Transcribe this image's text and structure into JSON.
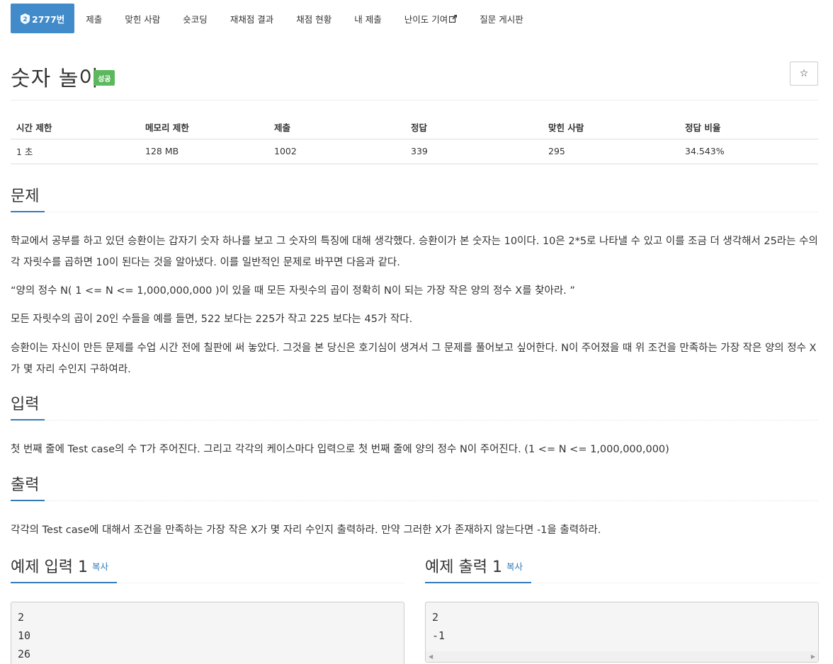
{
  "nav": {
    "problem_id": "2777번",
    "items": [
      "제출",
      "맞힌 사람",
      "숏코딩",
      "재채점 결과",
      "채점 현황",
      "내 제출",
      "난이도 기여",
      "질문 게시판"
    ]
  },
  "problem": {
    "title": "숫자 놀이",
    "status_badge": "성공",
    "star_icon": "☆"
  },
  "info_table": {
    "headers": [
      "시간 제한",
      "메모리 제한",
      "제출",
      "정답",
      "맞힌 사람",
      "정답 비율"
    ],
    "values": [
      "1 초",
      "128 MB",
      "1002",
      "339",
      "295",
      "34.543%"
    ]
  },
  "sections": {
    "description": {
      "heading": "문제",
      "paragraphs": [
        "학교에서 공부를 하고 있던 승환이는 갑자기 숫자 하나를 보고 그 숫자의 특징에 대해 생각했다. 승환이가 본 숫자는 10이다. 10은 2*5로 나타낼 수 있고 이를 조금 더 생각해서 25라는 수의 각 자릿수를 곱하면 10이 된다는 것을 알아냈다. 이를 일반적인 문제로 바꾸면 다음과 같다.",
        "“양의 정수 N( 1 <= N <= 1,000,000,000 )이 있을 때 모든 자릿수의 곱이 정확히 N이 되는 가장 작은 양의 정수 X를 찾아라. ”",
        "모든 자릿수의 곱이 20인 수들을 예를 들면, 522 보다는 225가 작고 225 보다는 45가 작다.",
        "승환이는 자신이 만든 문제를 수업 시간 전에 칠판에 써 놓았다. 그것을 본 당신은 호기심이 생겨서 그 문제를 풀어보고 싶어한다. N이 주어졌을 때 위 조건을 만족하는 가장 작은 양의 정수 X가 몇 자리 수인지 구하여라."
      ]
    },
    "input": {
      "heading": "입력",
      "text": "첫 번째 줄에 Test case의 수 T가 주어진다. 그리고 각각의 케이스마다 입력으로 첫 번째 줄에 양의 정수 N이 주어진다. (1 <= N <= 1,000,000,000)"
    },
    "output": {
      "heading": "출력",
      "text": "각각의 Test case에 대해서 조건을 만족하는 가장 작은 X가 몇 자리 수인지 출력하라. 만약 그러한 X가 존재하지 않는다면 -1을 출력하라."
    }
  },
  "samples": {
    "input": {
      "heading": "예제 입력 1",
      "copy_label": "복사",
      "content": "2\n10\n26"
    },
    "output": {
      "heading": "예제 출력 1",
      "copy_label": "복사",
      "content": "2\n-1"
    }
  },
  "colors": {
    "nav_active": "#428bca",
    "badge": "#5cb85c",
    "accent": "#337ab7"
  }
}
